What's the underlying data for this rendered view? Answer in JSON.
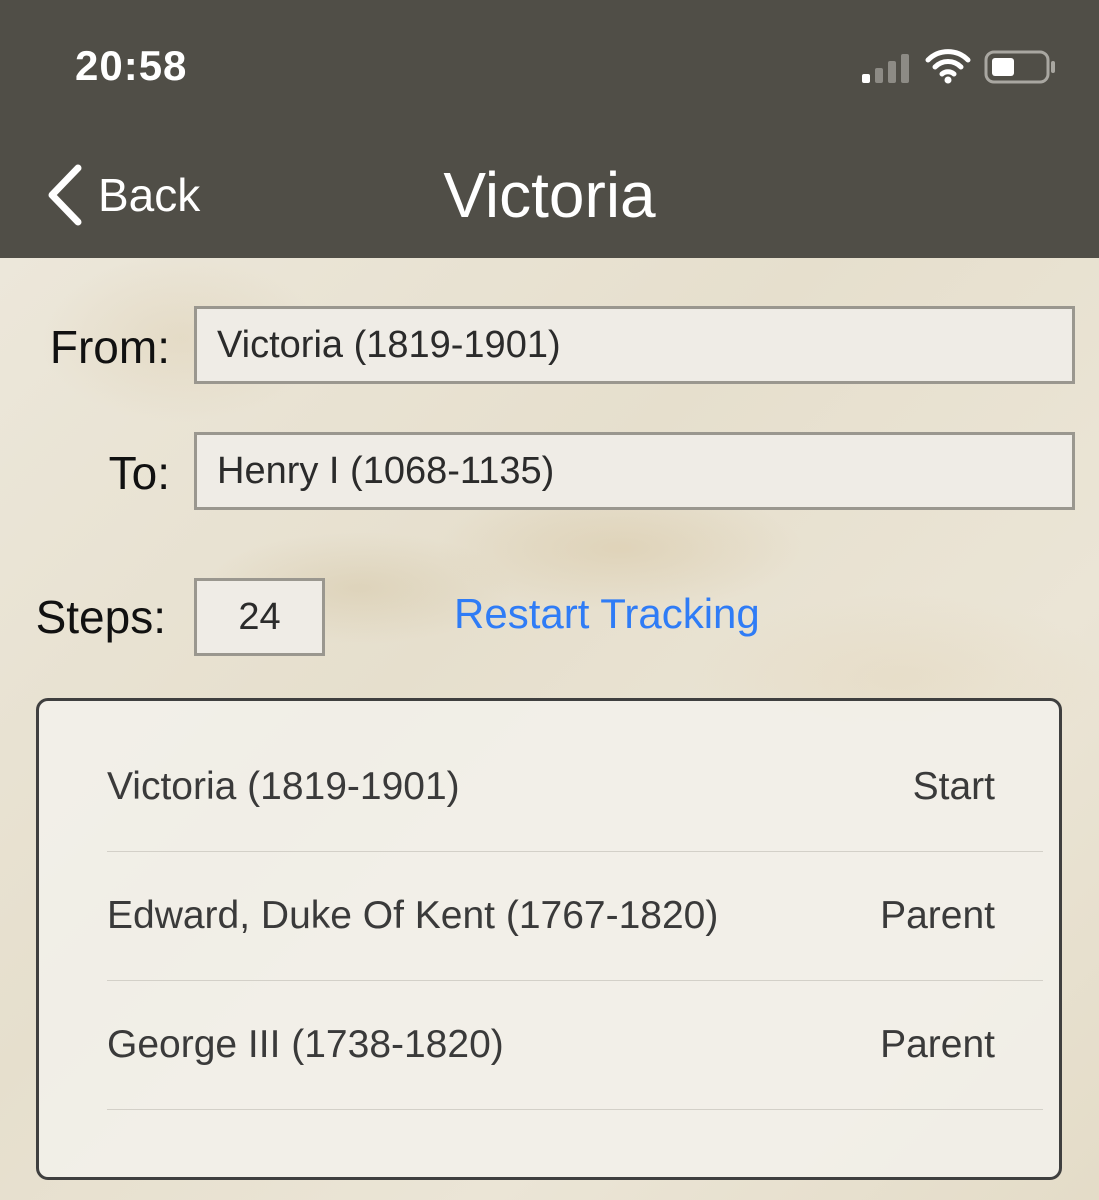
{
  "status_bar": {
    "time": "20:58"
  },
  "nav": {
    "back_label": "Back",
    "title": "Victoria"
  },
  "form": {
    "from_label": "From:",
    "from_value": "Victoria (1819-1901)",
    "to_label": "To:",
    "to_value": "Henry I (1068-1135)",
    "steps_label": "Steps:",
    "steps_value": "24",
    "restart_label": "Restart Tracking"
  },
  "path": [
    {
      "name": "Victoria (1819-1901)",
      "relation": "Start"
    },
    {
      "name": "Edward, Duke Of Kent (1767-1820)",
      "relation": "Parent"
    },
    {
      "name": "George III (1738-1820)",
      "relation": "Parent"
    }
  ],
  "colors": {
    "header_bg": "#504e47",
    "link": "#2f7cf6",
    "list_border": "#3f3f3f"
  },
  "icons": {
    "back": "chevron-left-icon",
    "signal": "cellular-signal-icon",
    "wifi": "wifi-icon",
    "battery": "battery-icon"
  }
}
